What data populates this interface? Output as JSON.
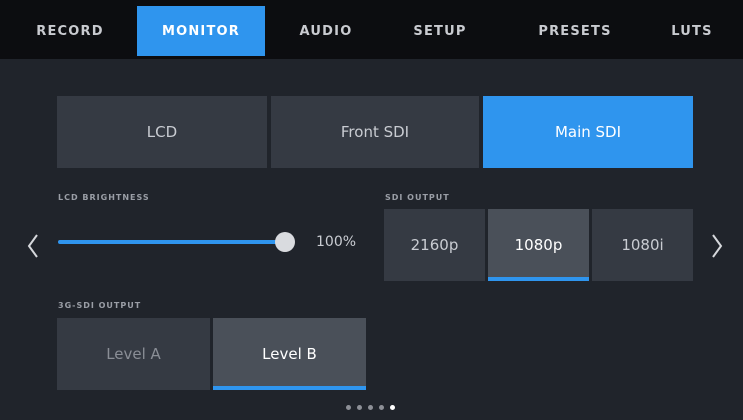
{
  "tabs": [
    "RECORD",
    "MONITOR",
    "AUDIO",
    "SETUP",
    "PRESETS",
    "LUTS"
  ],
  "active_tab": "MONITOR",
  "monitor_select": [
    "LCD",
    "Front SDI",
    "Main SDI"
  ],
  "monitor_selected": "Main SDI",
  "lcd_brightness": {
    "label": "LCD BRIGHTNESS",
    "value_text": "100%",
    "value": 100
  },
  "sdi_output": {
    "label": "SDI OUTPUT",
    "options": [
      "2160p",
      "1080p",
      "1080i"
    ],
    "selected": "1080p"
  },
  "sdi_3g_output": {
    "label": "3G-SDI OUTPUT",
    "options": [
      "Level A",
      "Level B"
    ],
    "selected": "Level B"
  },
  "page_indicator": {
    "total": 5,
    "current": 5
  },
  "colors": {
    "accent": "#2f95ee",
    "panel": "#20242b",
    "button": "#353a43"
  },
  "icons": {
    "prev": "chevron-left-icon",
    "next": "chevron-right-icon"
  }
}
